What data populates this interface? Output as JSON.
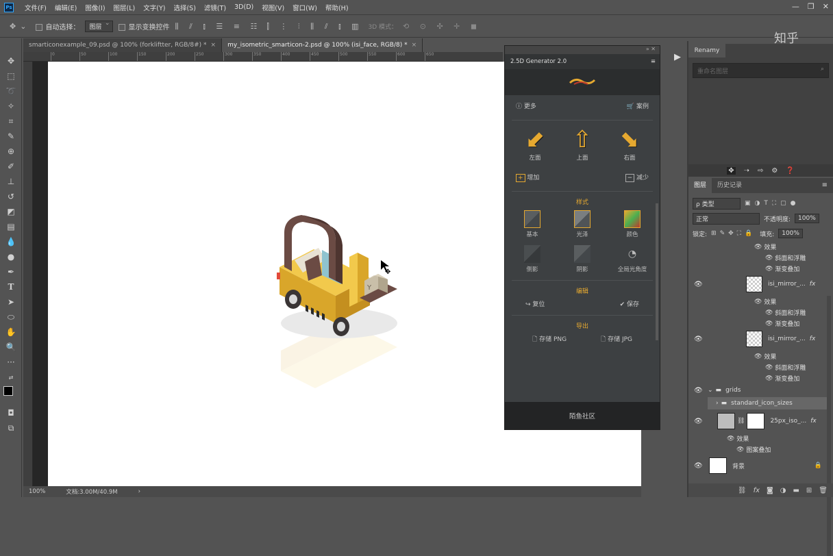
{
  "app": {
    "logo": "Ps"
  },
  "menu": [
    "文件(F)",
    "编辑(E)",
    "图像(I)",
    "图层(L)",
    "文字(Y)",
    "选择(S)",
    "滤镜(T)",
    "3D(D)",
    "视图(V)",
    "窗口(W)",
    "帮助(H)"
  ],
  "window_controls": {
    "minimize": "—",
    "restore": "❐",
    "close": "✕"
  },
  "options": {
    "auto_select_label": "自动选择：",
    "auto_select_value": "图层",
    "transform_label": "显示变换控件",
    "mode3d_label": "3D 模式："
  },
  "watermark": "知乎",
  "tabs": [
    {
      "label": "smarticonexample_09.psd @ 100% (forkliftter, RGB/8#) *",
      "close": "×"
    },
    {
      "label": "my_isometric_smarticon-2.psd @ 100% (isi_face, RGB/8) *",
      "close": "×"
    }
  ],
  "ruler_ticks": [
    "0",
    "50",
    "100",
    "150",
    "200",
    "250",
    "300",
    "350",
    "400",
    "450",
    "500",
    "550",
    "600",
    "650"
  ],
  "status": {
    "zoom": "100%",
    "doc": "文档:3.00M/40.9M",
    "arrow": "›"
  },
  "generator": {
    "title": "2.5D Generator 2.0",
    "more": "更多",
    "cases": "案例",
    "left": "左面",
    "top": "上面",
    "right": "右面",
    "increase": "增加",
    "decrease": "减少",
    "style_title": "样式",
    "styles": [
      "基本",
      "光泽",
      "颜色",
      "侧影",
      "阴影",
      "全局光角度"
    ],
    "edit_title": "编辑",
    "reset": "复位",
    "save": "保存",
    "export_title": "导出",
    "save_png": "存储 PNG",
    "save_jpg": "存储 JPG",
    "footer": "陌鱼社区"
  },
  "renamy": {
    "tab": "Renamy",
    "placeholder": "重命名图层"
  },
  "layers_panel": {
    "tab_layers": "图层",
    "tab_history": "历史记录",
    "filter_kind": "ρ 类型",
    "blend_mode": "正常",
    "opacity_label": "不透明度:",
    "opacity_value": "100%",
    "lock_label": "锁定:",
    "fill_label": "填充:",
    "fill_value": "100%",
    "rows": [
      {
        "text": "效果"
      },
      {
        "text": "斜面和浮雕"
      },
      {
        "text": "渐变叠加"
      },
      {
        "text": "isi_mirror_..."
      },
      {
        "text": "效果"
      },
      {
        "text": "斜面和浮雕"
      },
      {
        "text": "渐变叠加"
      },
      {
        "text": "isi_mirror_..."
      },
      {
        "text": "效果"
      },
      {
        "text": "斜面和浮雕"
      },
      {
        "text": "渐变叠加"
      },
      {
        "text": "grids"
      },
      {
        "text": "standard_icon_sizes"
      },
      {
        "text": "25px_iso_..."
      },
      {
        "text": "效果"
      },
      {
        "text": "图案叠加"
      },
      {
        "text": "背景"
      }
    ],
    "fx": "fx"
  },
  "colors": {
    "accent": "#e6a930",
    "forklift_yellow": "#f2c94c",
    "forklift_brown": "#6b4b44",
    "glass": "#8fc3cf"
  }
}
